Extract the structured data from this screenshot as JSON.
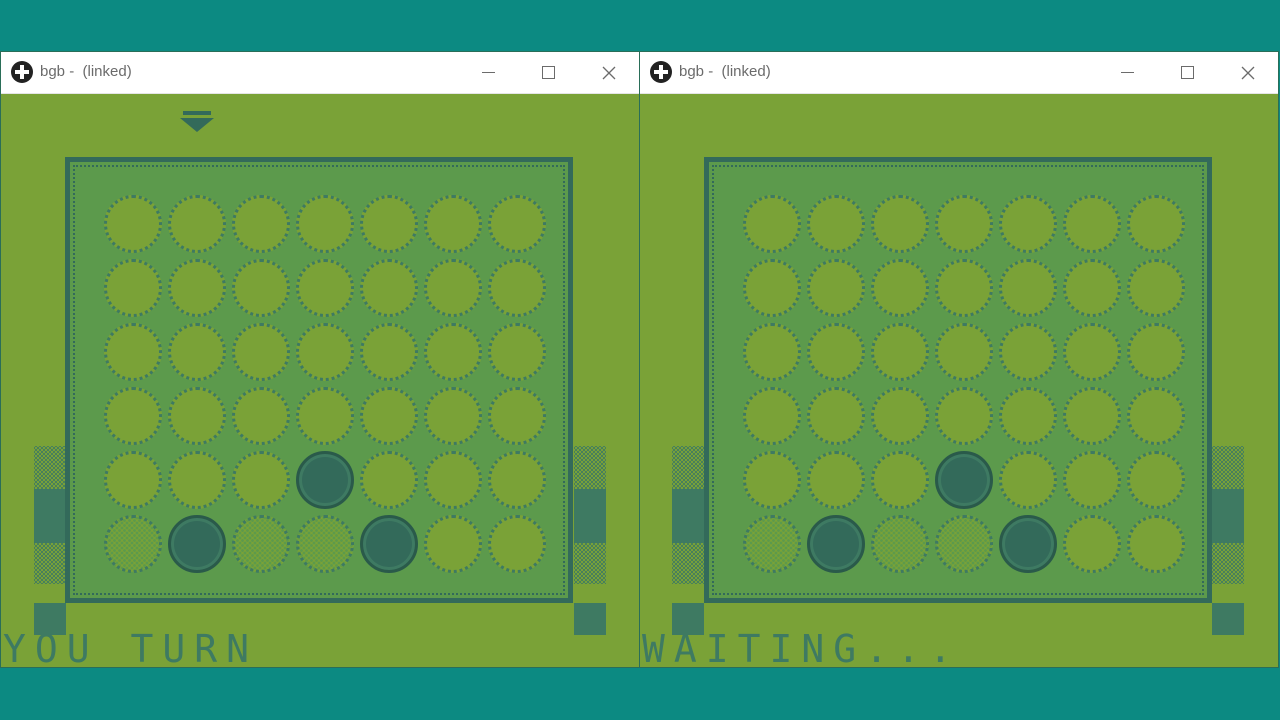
{
  "windows": [
    {
      "title": "bgb -  (linked)",
      "status": "YOU TURN",
      "show_pointer": true,
      "pointer_column": 1,
      "board": [
        [
          "empty",
          "empty",
          "empty",
          "empty",
          "empty",
          "empty",
          "empty"
        ],
        [
          "empty",
          "empty",
          "empty",
          "empty",
          "empty",
          "empty",
          "empty"
        ],
        [
          "empty",
          "empty",
          "empty",
          "empty",
          "empty",
          "empty",
          "empty"
        ],
        [
          "empty",
          "empty",
          "empty",
          "empty",
          "empty",
          "empty",
          "empty"
        ],
        [
          "empty",
          "empty",
          "empty",
          "dark",
          "empty",
          "empty",
          "empty"
        ],
        [
          "ghost",
          "dark",
          "ghost",
          "ghost",
          "dark",
          "empty",
          "empty"
        ]
      ]
    },
    {
      "title": "bgb -  (linked)",
      "status": "WAITING...",
      "show_pointer": false,
      "board": [
        [
          "empty",
          "empty",
          "empty",
          "empty",
          "empty",
          "empty",
          "empty"
        ],
        [
          "empty",
          "empty",
          "empty",
          "empty",
          "empty",
          "empty",
          "empty"
        ],
        [
          "empty",
          "empty",
          "empty",
          "empty",
          "empty",
          "empty",
          "empty"
        ],
        [
          "empty",
          "empty",
          "empty",
          "empty",
          "empty",
          "empty",
          "empty"
        ],
        [
          "empty",
          "empty",
          "empty",
          "dark",
          "empty",
          "empty",
          "empty"
        ],
        [
          "ghost",
          "dark",
          "ghost",
          "ghost",
          "dark",
          "empty",
          "empty"
        ]
      ]
    }
  ],
  "colors": {
    "desktop": "#0c8a82",
    "screen_light": "#7aa237",
    "screen_mid": "#5c9a4c",
    "screen_dark": "#336a5a"
  },
  "icons": {
    "app": "bgb-icon",
    "minimize": "minimize-icon",
    "maximize": "maximize-icon",
    "close": "close-icon",
    "pointer": "drop-pointer-icon"
  }
}
